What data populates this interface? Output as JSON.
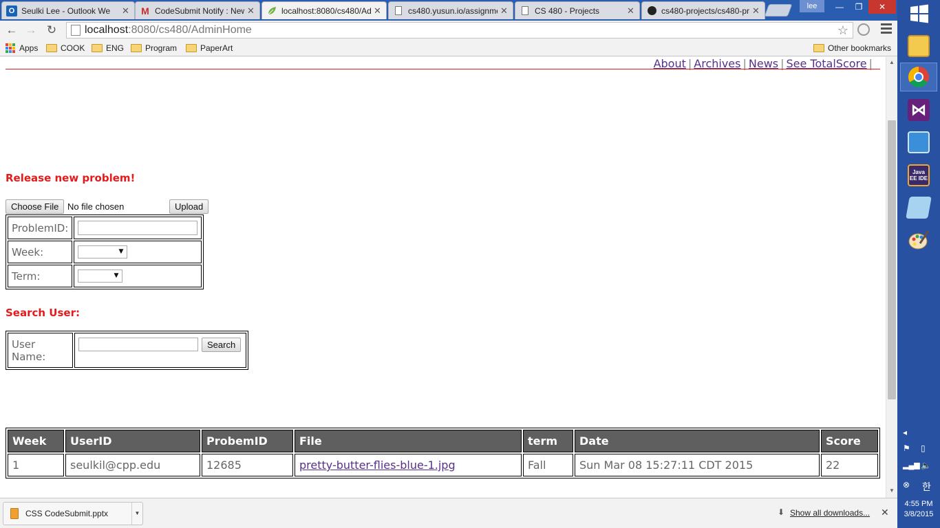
{
  "tabs": [
    {
      "label": "Seulki Lee - Outlook We",
      "icon": "outlook-icon",
      "active": false
    },
    {
      "label": "CodeSubmit Notify : New",
      "icon": "gmail-icon",
      "active": false
    },
    {
      "label": "localhost:8080/cs480/Ad",
      "icon": "leaf-icon",
      "active": true
    },
    {
      "label": "cs480.yusun.io/assignme",
      "icon": "page-icon",
      "active": false
    },
    {
      "label": "CS 480 - Projects",
      "icon": "page-icon",
      "active": false
    },
    {
      "label": "cs480-projects/cs480-pr",
      "icon": "github-icon",
      "active": false
    }
  ],
  "user_badge": "lee",
  "address_bar": {
    "host": "localhost",
    "path": ":8080/cs480/AdminHome"
  },
  "bookmarks": {
    "apps_label": "Apps",
    "items": [
      "COOK",
      "ENG",
      "Program",
      "PaperArt"
    ],
    "other_label": "Other bookmarks"
  },
  "top_nav": [
    "About",
    "Archives",
    "News",
    "See TotalScore"
  ],
  "release": {
    "heading": "Release new problem!",
    "choose_file_label": "Choose File",
    "no_file_text": "No file chosen",
    "upload_label": "Upload",
    "problem_id_label": "ProblemID:",
    "problem_id_value": "",
    "week_label": "Week:",
    "week_value": "",
    "term_label": "Term:",
    "term_value": ""
  },
  "search": {
    "heading": "Search User:",
    "user_name_label": "User Name:",
    "user_name_value": "",
    "search_label": "Search"
  },
  "submissions": {
    "headers": [
      "Week",
      "UserID",
      "ProbemID",
      "File",
      "term",
      "Date",
      "Score"
    ],
    "rows": [
      [
        "1",
        "seulkil@cpp.edu",
        "12685",
        "pretty-butter-flies-blue-1.jpg",
        "Fall",
        "Sun Mar 08 15:27:11 CDT 2015",
        "22"
      ]
    ]
  },
  "downloads": {
    "file_name": "CSS CodeSubmit.pptx",
    "show_all_label": "Show all downloads..."
  },
  "taskbar": {
    "pinned": [
      "file-explorer-icon",
      "chrome-icon",
      "visual-studio-icon",
      "remote-desktop-icon",
      "java-ee-ide-icon",
      "notepad-icon",
      "paint-icon"
    ],
    "java_ee_text": "Java EE IDE",
    "ime_label": "한",
    "time": "4:55 PM",
    "date": "3/8/2015"
  },
  "colors": {
    "heading_red": "#e21b1b",
    "link_purple": "#56308a",
    "table_header_bg": "#5f5f5f",
    "taskbar_blue": "#2852a1",
    "tabstrip_blue": "#2a5db0"
  }
}
